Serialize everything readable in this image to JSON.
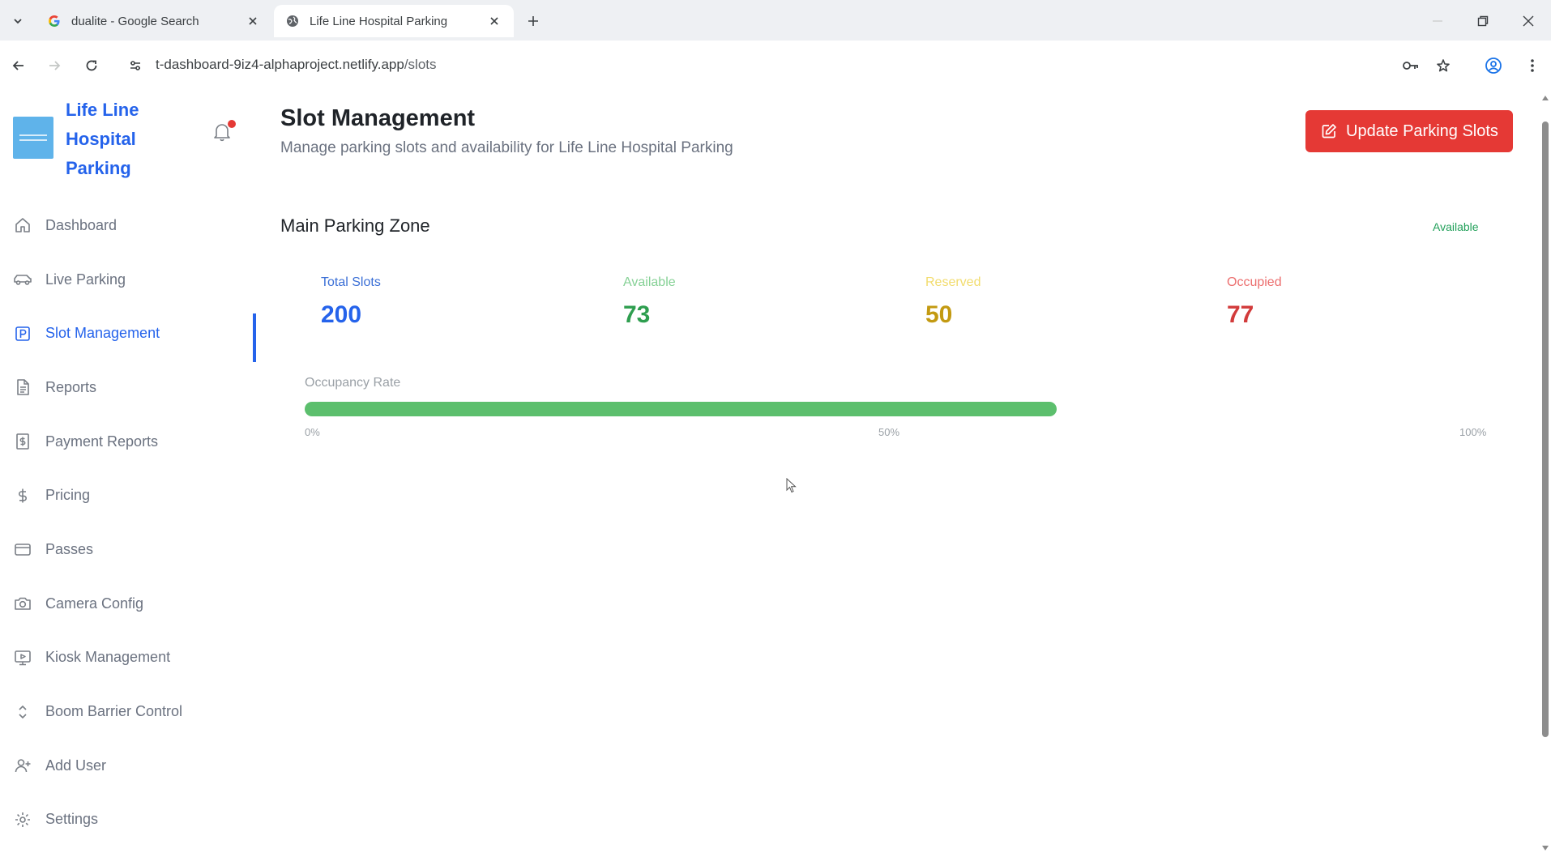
{
  "browser": {
    "tabs": [
      {
        "title": "dualite - Google Search",
        "favicon": "google-g-icon"
      },
      {
        "title": "Life Line Hospital Parking",
        "favicon": "globe-icon",
        "active": true
      }
    ],
    "url_host": "t-dashboard-9iz4-alphaproject.netlify.app",
    "url_path": "/slots"
  },
  "sidebar": {
    "brand": "Life Line Hospital Parking",
    "items": [
      {
        "label": "Dashboard",
        "icon": "home-icon"
      },
      {
        "label": "Live Parking",
        "icon": "car-icon"
      },
      {
        "label": "Slot Management",
        "icon": "parking-icon",
        "active": true
      },
      {
        "label": "Reports",
        "icon": "document-icon"
      },
      {
        "label": "Payment Reports",
        "icon": "receipt-dollar-icon"
      },
      {
        "label": "Pricing",
        "icon": "dollar-icon"
      },
      {
        "label": "Passes",
        "icon": "card-icon"
      },
      {
        "label": "Camera Config",
        "icon": "camera-icon"
      },
      {
        "label": "Kiosk Management",
        "icon": "monitor-play-icon"
      },
      {
        "label": "Boom Barrier Control",
        "icon": "chevrons-up-down-icon"
      },
      {
        "label": "Add User",
        "icon": "user-plus-icon"
      },
      {
        "label": "Settings",
        "icon": "gear-icon"
      }
    ]
  },
  "header": {
    "title": "Slot Management",
    "subtitle": "Manage parking slots and availability for Life Line Hospital Parking",
    "update_button": "Update Parking Slots"
  },
  "zone": {
    "title": "Main Parking Zone",
    "status": "Available",
    "stats": [
      {
        "label": "Total Slots",
        "value": "200"
      },
      {
        "label": "Available",
        "value": "73"
      },
      {
        "label": "Reserved",
        "value": "50"
      },
      {
        "label": "Occupied",
        "value": "77"
      }
    ],
    "occupancy_label": "Occupancy Rate",
    "occupancy_fraction": 0.635,
    "ticks": [
      "0%",
      "50%",
      "100%"
    ]
  },
  "colors": {
    "accent": "#2563eb",
    "danger": "#e53935",
    "success": "#5cbf6d"
  }
}
